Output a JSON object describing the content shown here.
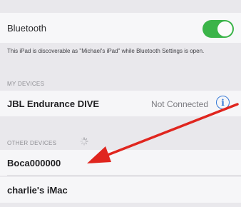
{
  "bluetooth": {
    "label": "Bluetooth",
    "toggle_state": "on",
    "toggle_color": "#3bb449",
    "footnote": "This iPad is discoverable as \"Michael's iPad\" while Bluetooth Settings is open."
  },
  "my_devices": {
    "header": "MY DEVICES",
    "items": [
      {
        "name": "JBL Endurance DIVE",
        "status": "Not Connected",
        "icon": "info-icon"
      }
    ]
  },
  "other_devices": {
    "header": "OTHER DEVICES",
    "icon": "activity-spinner-icon",
    "items": [
      {
        "name": "Boca000000"
      },
      {
        "name": "charlie's iMac"
      }
    ]
  },
  "annotation": {
    "color": "#e0261f",
    "icon": "arrow-annotation"
  },
  "colors": {
    "accent": "#3478d6",
    "toggle_on": "#3bb449",
    "annotation": "#e0261f"
  }
}
